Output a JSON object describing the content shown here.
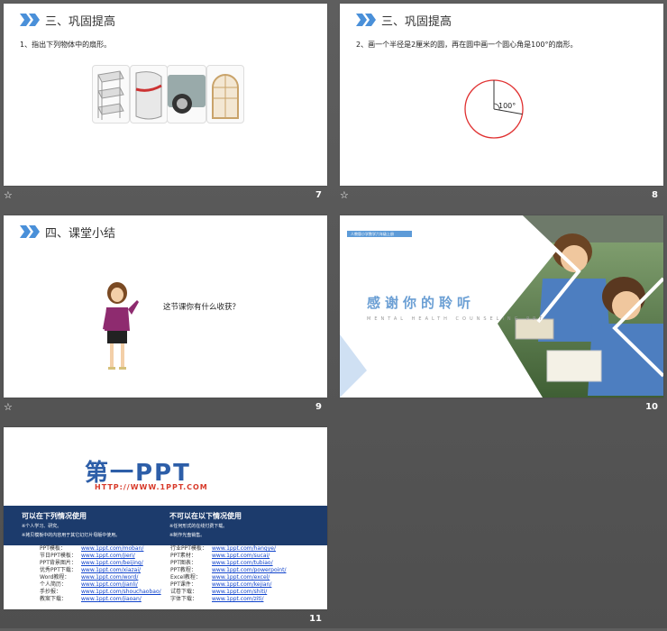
{
  "slides": [
    {
      "num": "7",
      "title": "三、巩固提高",
      "text": "1、指出下列物体中的扇形。",
      "icons": [
        "corner-shelf",
        "curved-cabinet",
        "car-wheel",
        "arched-window"
      ]
    },
    {
      "num": "8",
      "title": "三、巩固提高",
      "text": "2、画一个半径是2厘米的圆，再在圆中画一个圆心角是100°的扇形。",
      "angle_label": "100°",
      "angle": 100
    },
    {
      "num": "9",
      "title": "四、课堂小结",
      "question": "这节课你有什么收获？"
    },
    {
      "num": "10",
      "banner": "人教版小学数学六年级上册",
      "thanks": "感谢你的聆听",
      "subtitle": "MENTAL HEALTH COUNSELING PPT"
    },
    {
      "num": "11",
      "logo": "第一PPT",
      "url": "HTTP://WWW.1PPT.COM",
      "left_head": "可以在下列情况使用",
      "left_items": [
        "个人学习、研究。",
        "拷贝模板中的内容用于其它幻灯片母版中使用。"
      ],
      "right_head": "不可以在以下情况使用",
      "right_items": [
        "任何形式的在线付费下载。",
        "制作光盘销售。"
      ],
      "left_links": [
        {
          "label": "PPT模板：",
          "url": "www.1ppt.com/moban/"
        },
        {
          "label": "节日PPT模板：",
          "url": "www.1ppt.com/jieri/"
        },
        {
          "label": "PPT背景图片：",
          "url": "www.1ppt.com/beijing/"
        },
        {
          "label": "优秀PPT下载：",
          "url": "www.1ppt.com/xiazai/"
        },
        {
          "label": "Word教程：",
          "url": "www.1ppt.com/word/"
        },
        {
          "label": "个人简历：",
          "url": "www.1ppt.com/jianli/"
        },
        {
          "label": "手抄报：",
          "url": "www.1ppt.com/shouchaobao/"
        },
        {
          "label": "教案下载：",
          "url": "www.1ppt.com/jiaoan/"
        }
      ],
      "right_links": [
        {
          "label": "行业PPT模板：",
          "url": "www.1ppt.com/hangye/"
        },
        {
          "label": "PPT素材：",
          "url": "www.1ppt.com/sucai/"
        },
        {
          "label": "PPT图表：",
          "url": "www.1ppt.com/tubiao/"
        },
        {
          "label": "PPT教程：",
          "url": "www.1ppt.com/powerpoint/"
        },
        {
          "label": "Excel教程：",
          "url": "www.1ppt.com/excel/"
        },
        {
          "label": "PPT课件：",
          "url": "www.1ppt.com/kejian/"
        },
        {
          "label": "试卷下载：",
          "url": "www.1ppt.com/shiti/"
        },
        {
          "label": "字体下载：",
          "url": "www.1ppt.com/ziti/"
        }
      ]
    }
  ],
  "colors": {
    "accent": "#4a90d9",
    "title_blue": "#6b9fd4",
    "dark_blue": "#1c3b6c",
    "circle": "#e03030"
  }
}
